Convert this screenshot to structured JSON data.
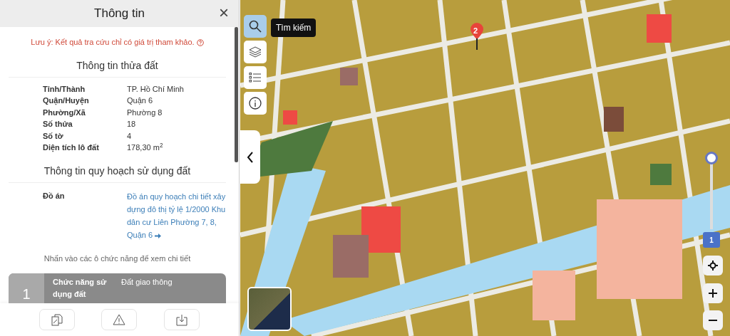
{
  "panel": {
    "title": "Thông tin",
    "close": "×",
    "notice": "Lưu ý: Kết quả tra cứu chỉ có giá trị tham khảo.",
    "parcel_heading": "Thông tin thửa đất",
    "parcel_rows": [
      {
        "label": "Tỉnh/Thành",
        "value": "TP. Hồ Chí Minh"
      },
      {
        "label": "Quận/Huyện",
        "value": "Quận 6"
      },
      {
        "label": "Phường/Xã",
        "value": "Phường 8"
      },
      {
        "label": "Số thửa",
        "value": "18"
      },
      {
        "label": "Số tờ",
        "value": "4"
      },
      {
        "label": "Diện tích lô đất",
        "value": "178,30 m$^{2}$"
      }
    ],
    "planning_heading": "Thông tin quy hoạch sử dụng đất",
    "plan_label": "Đồ án",
    "plan_link": "Đồ án quy hoạch chi tiết xây dựng đô thị tỷ lệ 1/2000 Khu dân cư Liên Phường 7, 8, Quận 6",
    "hint": "Nhấn vào các ô chức năng để xem chi tiết",
    "zones": [
      {
        "number": "1",
        "label": "Chức năng sử dụng đất",
        "value": "Đất giao thông"
      }
    ]
  },
  "map": {
    "tools": [
      {
        "kind": "search",
        "selected": true
      },
      {
        "kind": "layers",
        "selected": false
      },
      {
        "kind": "legend",
        "selected": false
      },
      {
        "kind": "info",
        "selected": false
      }
    ],
    "tooltip": "Tìm kiếm",
    "marker": "2",
    "slider": {
      "level": 1,
      "reading": "1"
    }
  }
}
